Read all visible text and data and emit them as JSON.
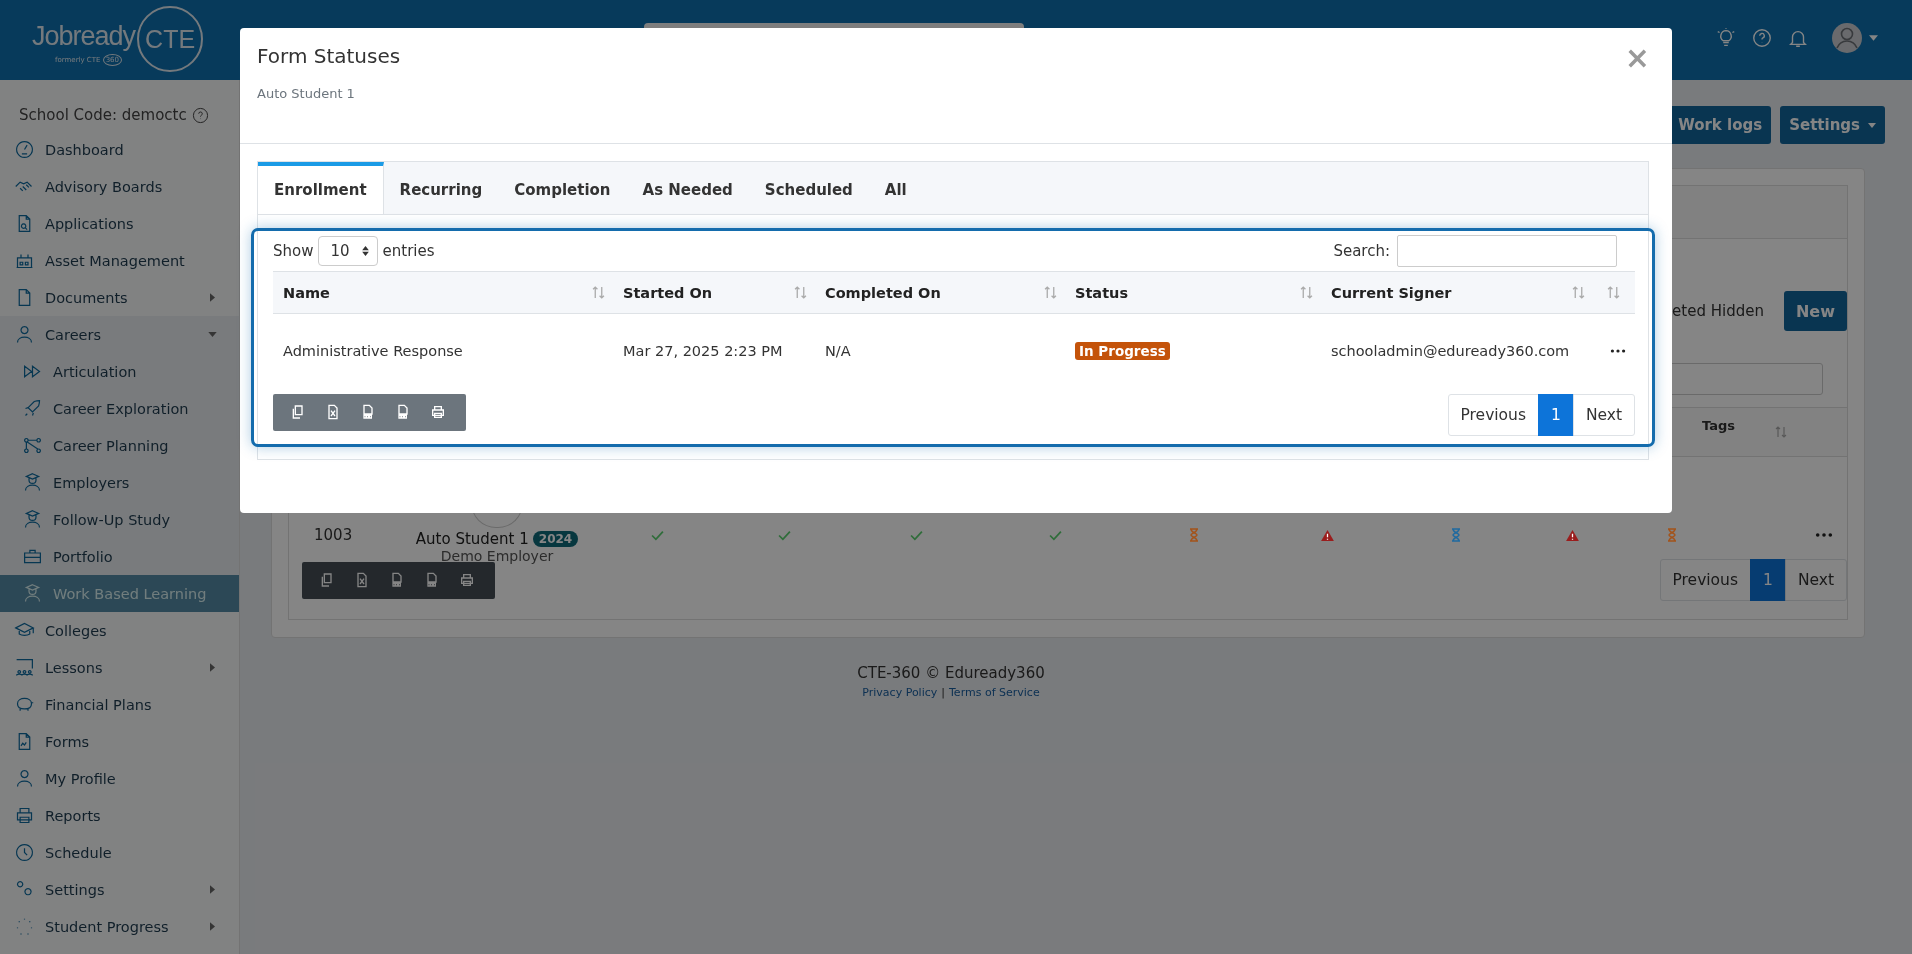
{
  "header": {
    "logo_word": "Jobready",
    "logo_circle": "CTE",
    "logo_sub": "formerly CTE",
    "logo_sub_circle": "360"
  },
  "sidebar": {
    "school_code": "School Code: democtc",
    "items": [
      {
        "label": "Dashboard",
        "kind": "link",
        "selected": false
      },
      {
        "label": "Advisory Boards",
        "kind": "link",
        "selected": false
      },
      {
        "label": "Applications",
        "kind": "link",
        "selected": false
      },
      {
        "label": "Asset Management",
        "kind": "link",
        "selected": false
      },
      {
        "label": "Documents",
        "kind": "submenu",
        "expanded": false,
        "selected": false
      },
      {
        "label": "Careers",
        "kind": "submenu",
        "expanded": true,
        "selected": false,
        "children": [
          {
            "label": "Articulation",
            "selected": false
          },
          {
            "label": "Career Exploration",
            "selected": false
          },
          {
            "label": "Career Planning",
            "selected": false
          },
          {
            "label": "Employers",
            "selected": false
          },
          {
            "label": "Follow-Up Study",
            "selected": false
          },
          {
            "label": "Portfolio",
            "selected": false
          },
          {
            "label": "Work Based Learning",
            "selected": true
          }
        ]
      },
      {
        "label": "Colleges",
        "kind": "link",
        "selected": false
      },
      {
        "label": "Lessons",
        "kind": "submenu",
        "expanded": false,
        "selected": false
      },
      {
        "label": "Financial Plans",
        "kind": "link",
        "selected": false
      },
      {
        "label": "Forms",
        "kind": "link",
        "selected": false
      },
      {
        "label": "My Profile",
        "kind": "link",
        "selected": false
      },
      {
        "label": "Reports",
        "kind": "link",
        "selected": false
      },
      {
        "label": "Schedule",
        "kind": "link",
        "selected": false
      },
      {
        "label": "Settings",
        "kind": "submenu",
        "expanded": false,
        "selected": false
      },
      {
        "label": "Student Progress",
        "kind": "submenu",
        "expanded": false,
        "selected": false
      }
    ]
  },
  "toolbar_buttons": [
    {
      "label": "Work logs",
      "dropdown": false
    },
    {
      "label": "Settings",
      "dropdown": true
    }
  ],
  "card": {
    "filter_text": "eted Hidden",
    "new_button": "New",
    "columns": [
      {
        "label": "Tags"
      }
    ],
    "rows": [
      {
        "id": "1003",
        "name": "Auto Student 1",
        "year": "2024",
        "employer": "Demo Employer",
        "statuses": [
          {
            "kind": "check",
            "color": "#2f6d3a"
          },
          {
            "kind": "check",
            "color": "#2f6d3a"
          },
          {
            "kind": "check",
            "color": "#2f6d3a"
          },
          {
            "kind": "check",
            "color": "#2f6d3a"
          },
          {
            "kind": "pending",
            "color": "#a3531a"
          },
          {
            "kind": "warning",
            "color": "#9a1d1d"
          },
          {
            "kind": "pending",
            "color": "#1f6aa0"
          },
          {
            "kind": "warning",
            "color": "#9a1d1d"
          },
          {
            "kind": "pending",
            "color": "#a3531a"
          }
        ]
      }
    ],
    "pagination": {
      "previous": "Previous",
      "pages": [
        {
          "label": "1",
          "selected": true
        }
      ],
      "next": "Next"
    }
  },
  "footer": {
    "copyright": "CTE-360 © Eduready360",
    "links": [
      "Privacy Policy",
      "Terms of Service"
    ],
    "separator": "|"
  },
  "modal": {
    "title": "Form Statuses",
    "subtitle": "Auto Student 1",
    "close": "×",
    "tabs": [
      {
        "label": "Enrollment",
        "selected": true
      },
      {
        "label": "Recurring",
        "selected": false
      },
      {
        "label": "Completion",
        "selected": false
      },
      {
        "label": "As Needed",
        "selected": false
      },
      {
        "label": "Scheduled",
        "selected": false
      },
      {
        "label": "All",
        "selected": false
      }
    ],
    "length_before": "Show",
    "page_length": "10",
    "length_after": "entries",
    "search_label": "Search:",
    "columns": [
      "Name",
      "Started On",
      "Completed On",
      "Status",
      "Current Signer"
    ],
    "rows": [
      {
        "name": "Administrative Response",
        "started_on": "Mar 27, 2025 2:23 PM",
        "completed_on": "N/A",
        "status": "In Progress",
        "current_signer": "schooladmin@eduready360.com"
      }
    ],
    "export_buttons": [
      {
        "kind": "copy"
      },
      {
        "kind": "excel"
      },
      {
        "kind": "csv"
      },
      {
        "kind": "pdf"
      },
      {
        "kind": "print"
      }
    ],
    "pagination": {
      "previous": "Previous",
      "pages": [
        {
          "label": "1",
          "selected": true
        }
      ],
      "next": "Next"
    }
  }
}
